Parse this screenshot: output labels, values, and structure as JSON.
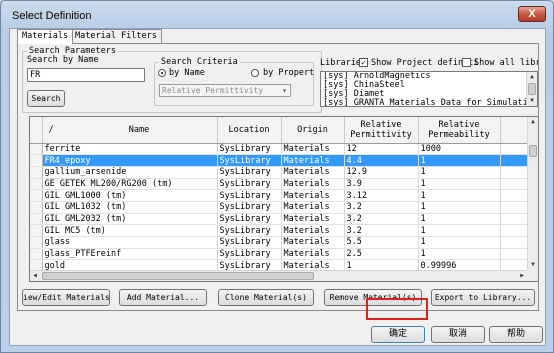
{
  "window": {
    "title": "Select Definition",
    "close_label": "X"
  },
  "tabs": [
    {
      "label": "Materials",
      "active": true
    },
    {
      "label": "Material Filters",
      "active": false
    }
  ],
  "search_parameters": {
    "legend": "Search Parameters",
    "search_by_name_label": "Search by Name",
    "search_value": "FR",
    "search_button": "Search"
  },
  "search_criteria": {
    "legend": "Search Criteria",
    "by_name_label": "by Name",
    "by_property_label": "by Propert",
    "selected": "by Name",
    "property_select_value": "Relative Permittivity"
  },
  "libraries": {
    "label": "Libraries",
    "show_project_label": "Show Project definiti",
    "show_project_checked": true,
    "show_all_label": "Show all librai",
    "show_all_checked": false,
    "items": [
      "[sys] ArnoldMagnetics",
      "[sys] ChinaSteel",
      "[sys] Diamet",
      "[sys] GRANTA Materials Data for Simulation"
    ]
  },
  "table": {
    "columns": [
      {
        "label": "/"
      },
      {
        "label": "Name"
      },
      {
        "label": "Location"
      },
      {
        "label": "Origin"
      },
      {
        "label": "Relative\nPermittivity"
      },
      {
        "label": "Relative\nPermeability"
      }
    ],
    "selected_index": 1,
    "rows": [
      {
        "name": "ferrite",
        "location": "SysLibrary",
        "origin": "Materials",
        "permittivity": "12",
        "permeability": "1000"
      },
      {
        "name": "FR4_epoxy",
        "location": "SysLibrary",
        "origin": "Materials",
        "permittivity": "4.4",
        "permeability": "1"
      },
      {
        "name": "gallium_arsenide",
        "location": "SysLibrary",
        "origin": "Materials",
        "permittivity": "12.9",
        "permeability": "1"
      },
      {
        "name": "GE GETEK ML200/RG200 (tm)",
        "location": "SysLibrary",
        "origin": "Materials",
        "permittivity": "3.9",
        "permeability": "1"
      },
      {
        "name": "GIL GML1000 (tm)",
        "location": "SysLibrary",
        "origin": "Materials",
        "permittivity": "3.12",
        "permeability": "1"
      },
      {
        "name": "GIL GML1032 (tm)",
        "location": "SysLibrary",
        "origin": "Materials",
        "permittivity": "3.2",
        "permeability": "1"
      },
      {
        "name": "GIL GML2032 (tm)",
        "location": "SysLibrary",
        "origin": "Materials",
        "permittivity": "3.2",
        "permeability": "1"
      },
      {
        "name": "GIL MC5 (tm)",
        "location": "SysLibrary",
        "origin": "Materials",
        "permittivity": "3.2",
        "permeability": "1"
      },
      {
        "name": "glass",
        "location": "SysLibrary",
        "origin": "Materials",
        "permittivity": "5.5",
        "permeability": "1"
      },
      {
        "name": "glass_PTFEreinf",
        "location": "SysLibrary",
        "origin": "Materials",
        "permittivity": "2.5",
        "permeability": "1"
      },
      {
        "name": "gold",
        "location": "SysLibrary",
        "origin": "Materials",
        "permittivity": "1",
        "permeability": "0.99996"
      }
    ]
  },
  "actions": {
    "view_edit": "iew/Edit Materials...",
    "add": "Add Material...",
    "clone": "Clone Material(s)",
    "remove": "Remove Material(s)",
    "export": "Export to Library..."
  },
  "footer": {
    "ok": "确定",
    "cancel": "取消",
    "help": "帮助"
  },
  "colors": {
    "selection": "#3399ff",
    "highlight_box": "#e0201a"
  }
}
